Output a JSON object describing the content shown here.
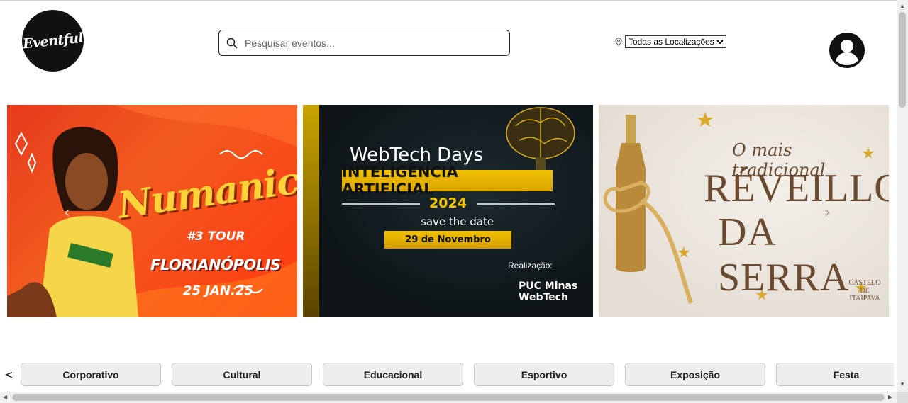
{
  "header": {
    "logo_text": "Eventful",
    "search_placeholder": "Pesquisar eventos...",
    "location_select": {
      "selected": "Todas as Localizações",
      "icon": "map-pin-icon"
    },
    "avatar_icon": "user-circle-icon"
  },
  "carousel": {
    "slides": [
      {
        "title": "Numanice",
        "tour": "#3 TOUR",
        "city": "FLORIANÓPOLIS",
        "date": "25 JAN.25"
      },
      {
        "title": "WebTech Days",
        "subtitle": "INTELIGÊNCIA ARTIFICIAL",
        "year": "2024",
        "save_the_date": "save the date",
        "date": "29 de Novembro",
        "realizacao": "Realização:",
        "organizer": "PUC Minas WebTech"
      },
      {
        "tagline": "O mais tradicional",
        "title_line1": "RÉVEILLON",
        "title_line2": "DA SERRA",
        "brand": "CASTELO DE ITAIPAVA"
      }
    ],
    "prev_icon": "‹",
    "next_icon": "›"
  },
  "categories": {
    "prev_label": "<",
    "items": [
      "Corporativo",
      "Cultural",
      "Educacional",
      "Esportivo",
      "Exposição",
      "Festa"
    ]
  },
  "colors": {
    "logo_bg": "#111111",
    "category_bg": "#eeeeee",
    "accent_gold": "#f2c200"
  }
}
